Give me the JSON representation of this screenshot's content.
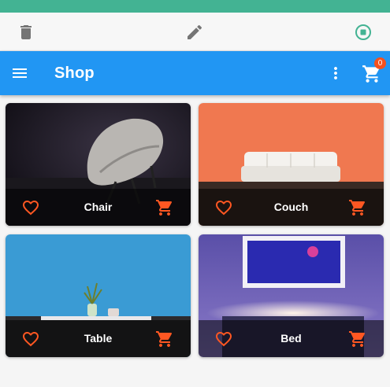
{
  "colors": {
    "status_bar": "#43b393",
    "appbar": "#2196f3",
    "accent": "#ff5722",
    "badge": "#f4511e"
  },
  "toolbar": {
    "icons": [
      "delete-icon",
      "edit-icon",
      "stop-circle-icon"
    ]
  },
  "appbar": {
    "title": "Shop",
    "cart_count": "0"
  },
  "products": [
    {
      "name": "Chair"
    },
    {
      "name": "Couch"
    },
    {
      "name": "Table"
    },
    {
      "name": "Bed"
    }
  ]
}
